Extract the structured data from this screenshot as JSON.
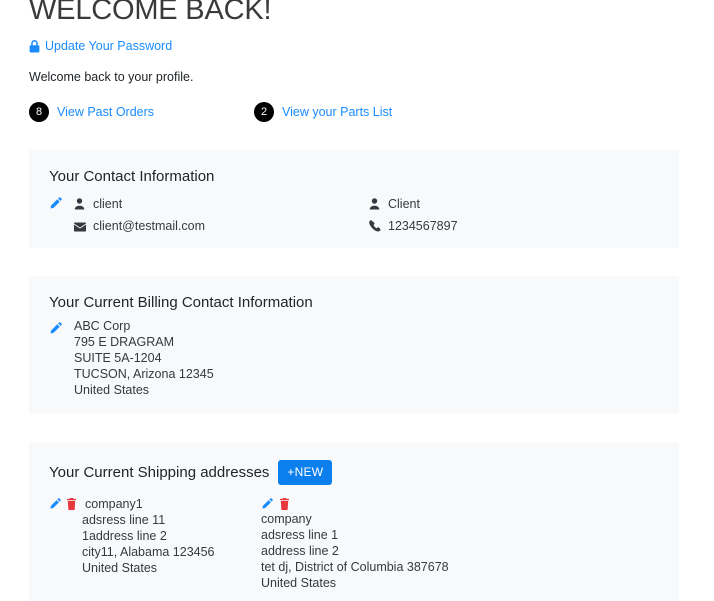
{
  "header": {
    "title": "WELCOME BACK!",
    "password_link": "Update Your Password",
    "password_icon": "lock-icon",
    "subtitle": "Welcome back to your profile.",
    "quick_links": [
      {
        "count": "8",
        "label": "View Past Orders"
      },
      {
        "count": "2",
        "label": "View your Parts List"
      }
    ]
  },
  "contact_card": {
    "title": "Your Contact Information",
    "edit_icon": "pencil-icon",
    "left": [
      {
        "icon": "user-icon",
        "value": "client"
      },
      {
        "icon": "envelope-icon",
        "value": "client@testmail.com"
      }
    ],
    "right": [
      {
        "icon": "user-icon",
        "value": "Client"
      },
      {
        "icon": "phone-icon",
        "value": "1234567897"
      }
    ]
  },
  "billing_card": {
    "title": "Your Current Billing Contact Information",
    "edit_icon": "pencil-icon",
    "address": [
      "ABC Corp",
      "795 E DRAGRAM",
      "SUITE 5A-1204",
      "TUCSON, Arizona 12345",
      "United States"
    ]
  },
  "shipping_card": {
    "title": "Your Current Shipping addresses",
    "new_button": "+NEW",
    "addresses": [
      {
        "name": "company1",
        "lines": [
          "adsress line 11",
          "1address line 2",
          "city11, Alabama 123456",
          "United States"
        ]
      },
      {
        "name": "company",
        "lines": [
          "adsress line 1",
          "address line 2",
          "tet dj, District of Columbia 387678",
          "United States"
        ]
      }
    ],
    "edit_icon": "pencil-icon",
    "delete_icon": "trash-icon"
  },
  "colors": {
    "link_blue": "#1a8cff",
    "button_blue": "#0d7fec",
    "badge_black": "#000000",
    "card_bg": "#f8f9fb",
    "trash_red": "#e8363d",
    "text_dark": "#343a40"
  }
}
